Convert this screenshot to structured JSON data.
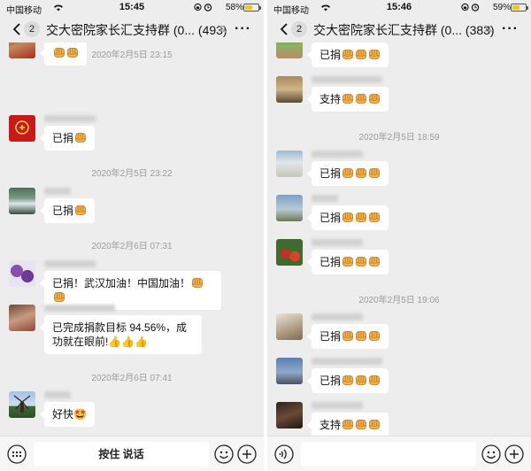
{
  "left": {
    "status": {
      "carrier": "中国移动",
      "time": "15:45",
      "battery": "58%",
      "battery_level": 0.58
    },
    "nav": {
      "badge": "2",
      "title": "交大密院家长汇支持群 (0...",
      "count": "(493)"
    },
    "messages": [
      {
        "type": "msg",
        "avatar": "avatar-person",
        "text": "",
        "emoji": 2
      },
      {
        "type": "time",
        "text": "2020年2月5日 23:15"
      },
      {
        "type": "msg",
        "avatar": "avatar-red-logo",
        "text": "已捐",
        "emoji": 1
      },
      {
        "type": "time",
        "text": "2020年2月5日 23:22"
      },
      {
        "type": "msg",
        "avatar": "avatar-landscape",
        "text": "已捐",
        "emoji": 1
      },
      {
        "type": "time",
        "text": "2020年2月6日 07:31"
      },
      {
        "type": "msg",
        "avatar": "avatar-flowers",
        "text": "已捐！武汉加油！中国加油！",
        "emoji": 2
      },
      {
        "type": "msg",
        "avatar": "avatar-child",
        "text": "已完成捐款目标 94.56%，成功就在眼前!👍👍👍",
        "emoji": 0
      },
      {
        "type": "time",
        "text": "2020年2月6日 07:41"
      },
      {
        "type": "msg",
        "avatar": "avatar-windmill",
        "text": "好快🤩",
        "emoji": 0
      }
    ],
    "inputbar": {
      "voice_label": "按住 说话"
    }
  },
  "right": {
    "status": {
      "carrier": "中国移动",
      "time": "15:46",
      "battery": "59%",
      "battery_level": 0.59
    },
    "nav": {
      "badge": "2",
      "title": "交大密院家长汇支持群 (0...",
      "count": "(383)"
    },
    "messages": [
      {
        "type": "msg",
        "avatar": "avatar-garden",
        "text": "已捐",
        "emoji": 3
      },
      {
        "type": "msg",
        "avatar": "avatar-building",
        "text": "支持",
        "emoji": 3
      },
      {
        "type": "time",
        "text": "2020年2月5日 18:59"
      },
      {
        "type": "msg",
        "avatar": "avatar-silos",
        "text": "已捐",
        "emoji": 3
      },
      {
        "type": "msg",
        "avatar": "avatar-standing",
        "text": "已捐",
        "emoji": 3
      },
      {
        "type": "msg",
        "avatar": "avatar-fruit",
        "text": "已捐",
        "emoji": 3
      },
      {
        "type": "time",
        "text": "2020年2月5日 19:06"
      },
      {
        "type": "msg",
        "avatar": "avatar-woman",
        "text": "已捐",
        "emoji": 3
      },
      {
        "type": "msg",
        "avatar": "avatar-city",
        "text": "已捐",
        "emoji": 3
      },
      {
        "type": "msg",
        "avatar": "avatar-violin",
        "text": "支持",
        "emoji": 3
      }
    ]
  },
  "colors": {
    "chat_bg": "#ededed",
    "bubble": "#ffffff",
    "timestamp": "#9b9b9b",
    "battery_fill": "#f2c233"
  },
  "icons": {
    "back": "chevron-left-icon",
    "mute": "bell-off-icon",
    "more": "more-icon",
    "keyboard": "keyboard-icon",
    "voice": "voice-icon",
    "emoji": "smiley-icon",
    "plus": "plus-icon",
    "fist": "fist-emoji"
  }
}
